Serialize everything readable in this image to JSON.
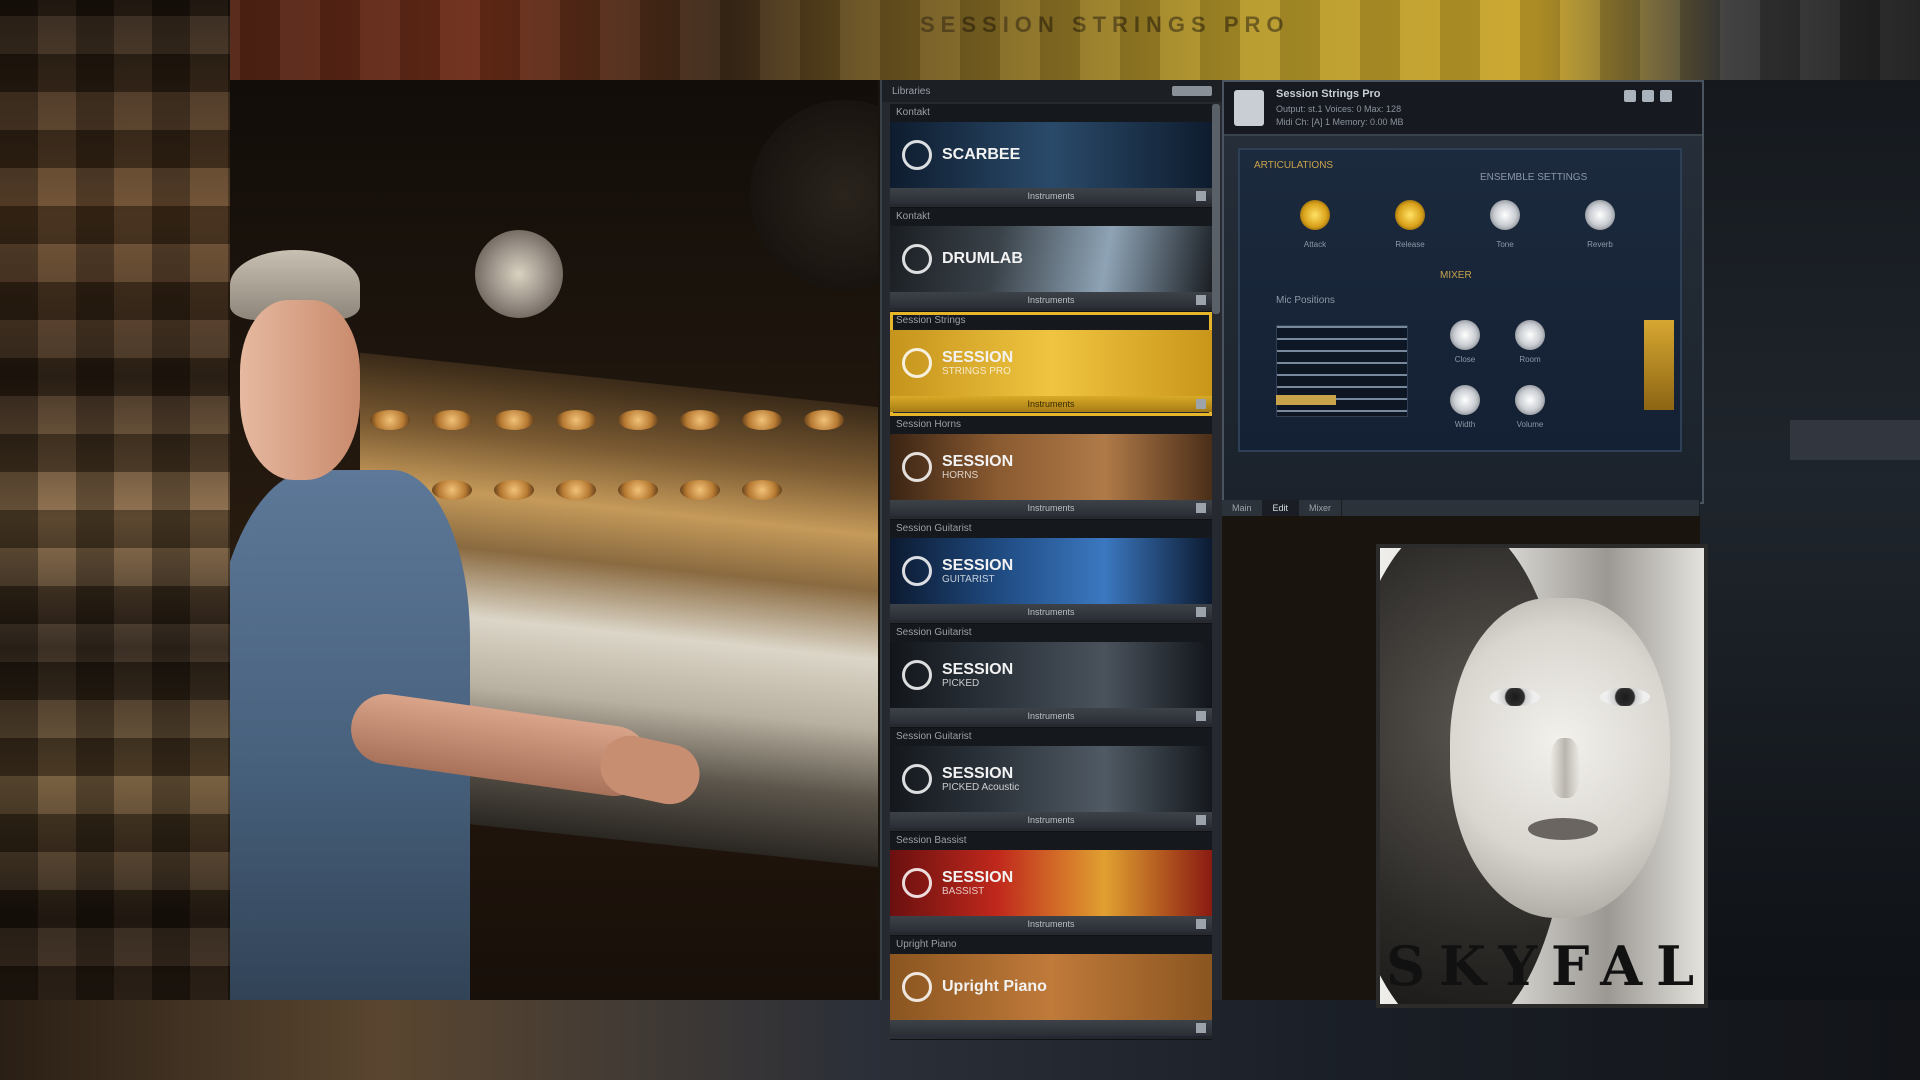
{
  "colors": {
    "accent_gold": "#e7b52a",
    "panel_dark": "#262a30",
    "instrument_blue": "#1c2a3e"
  },
  "browser": {
    "header_label": "Libraries",
    "items": [
      {
        "category": "Kontakt",
        "name": "SCARBEE",
        "sub": "",
        "footer": "Instruments",
        "bg": "linear-gradient(90deg,#0e1c2e,#2a4a6a,#0e1c2e)"
      },
      {
        "category": "Kontakt",
        "name": "DRUMLAB",
        "sub": "",
        "footer": "Instruments",
        "bg": "linear-gradient(100deg,#1a1e23,#3a4249,#8ea3b5,#1a1e23)"
      },
      {
        "category": "Session Strings",
        "name": "SESSION",
        "sub": "STRINGS PRO",
        "footer": "Instruments",
        "bg": "linear-gradient(90deg,#c5941c,#f0c440,#c9961a)"
      },
      {
        "category": "Session Horns",
        "name": "SESSION",
        "sub": "HORNS",
        "footer": "Instruments",
        "bg": "linear-gradient(90deg,#3a2414,#8a5a30,#b07a48,#4a2e18)"
      },
      {
        "category": "Session Guitarist",
        "name": "SESSION",
        "sub": "GUITARIST",
        "footer": "Instruments",
        "bg": "linear-gradient(90deg,#0c1a30,#1f4a80,#3b78c0,#0c1a30)"
      },
      {
        "category": "Session Guitarist",
        "name": "SESSION",
        "sub": "PICKED",
        "footer": "Instruments",
        "bg": "linear-gradient(90deg,#12161b,#2c333b,#4a525c,#12161b)"
      },
      {
        "category": "Session Guitarist",
        "name": "SESSION",
        "sub": "PICKED Acoustic",
        "footer": "Instruments",
        "bg": "linear-gradient(90deg,#14181d,#2e353d,#505a64,#14181d)"
      },
      {
        "category": "Session Bassist",
        "name": "SESSION",
        "sub": "BASSIST",
        "footer": "Instruments",
        "bg": "linear-gradient(90deg,#6a1010,#c0281c,#e0a030,#8a1a12)"
      },
      {
        "category": "Upright Piano",
        "name": "Upright Piano",
        "sub": "",
        "footer": "",
        "bg": "linear-gradient(90deg,#8a5520,#c07a3a,#8a5520)"
      }
    ]
  },
  "instrument": {
    "name": "Session Strings Pro",
    "row2": "Output: st.1   Voices: 0   Max: 128",
    "row3": "Midi Ch: [A] 1   Memory: 0.00 MB",
    "section1": "ARTICULATIONS",
    "section1_right": "ENSEMBLE SETTINGS",
    "knobs_top": [
      "Attack",
      "Release",
      "Tone",
      "Reverb"
    ],
    "section2": "MIXER",
    "section2_label": "Mic Positions",
    "knobs_bottom": [
      "Close",
      "Room",
      "Width",
      "Volume"
    ]
  },
  "tabs": [
    "Main",
    "Edit",
    "Mixer"
  ],
  "album": {
    "title": "SKYFAL"
  },
  "top_blur_text": "SESSION STRINGS PRO"
}
